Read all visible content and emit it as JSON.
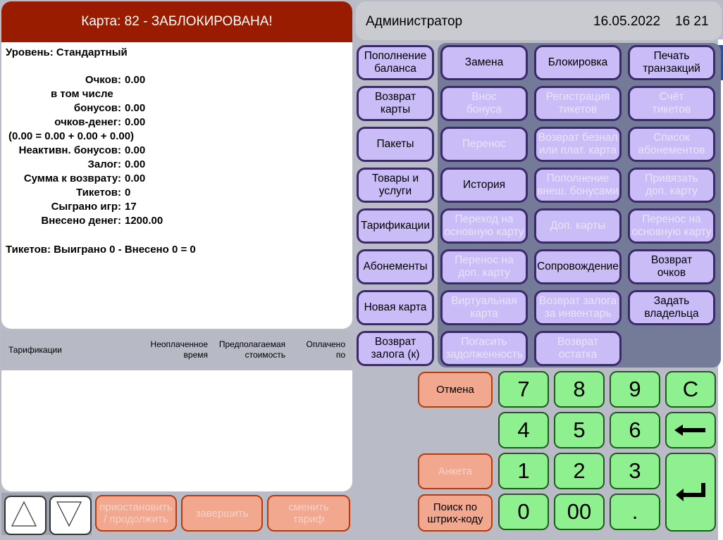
{
  "card": {
    "title": "Карта: 82  - ЗАБЛОКИРОВАНА!",
    "level": "Уровень: Стандартный",
    "stats": [
      {
        "label": "Очков:",
        "value": "0.00"
      },
      {
        "label": "в том числе",
        "value": ""
      },
      {
        "label": "бонусов:",
        "value": "0.00"
      },
      {
        "label": "очков-денег:",
        "value": "0.00"
      },
      {
        "label": "(0.00 = 0.00 + 0.00 + 0.00)",
        "value": ""
      },
      {
        "label": "Неактивн. бонусов:",
        "value": "0.00"
      },
      {
        "label": "Залог:",
        "value": "0.00"
      },
      {
        "label": "Сумма к возврату:",
        "value": "0.00"
      },
      {
        "label": "Тикетов:",
        "value": "0"
      },
      {
        "label": "Сыграно игр:",
        "value": "17"
      },
      {
        "label": "Внесено денег:",
        "value": "1200.00"
      }
    ],
    "tickets_summary": "Тикетов: Выиграно 0 - Внесено 0 = 0"
  },
  "tariffs": {
    "col_name": "Тарификации",
    "col_unpaid_1": "Неоплаченное",
    "col_unpaid_2": "время",
    "col_cost_1": "Предполагаемая",
    "col_cost_2": "стоимость",
    "col_paid_1": "Оплачено",
    "col_paid_2": "по"
  },
  "bottom": {
    "pause_1": "приостановить",
    "pause_2": "/ продолжить",
    "finish": "завершить",
    "change_1": "сменить",
    "change_2": "тариф"
  },
  "header": {
    "user": "Администратор",
    "date": "16.05.2022",
    "time": "16 21"
  },
  "left_column": [
    {
      "l1": "Пополнение",
      "l2": "баланса"
    },
    {
      "l1": "Возврат",
      "l2": "карты"
    },
    {
      "l1": "Пакеты",
      "l2": ""
    },
    {
      "l1": "Товары и",
      "l2": "услуги"
    },
    {
      "l1": "Тарификации",
      "l2": ""
    },
    {
      "l1": "Абонементы",
      "l2": ""
    },
    {
      "l1": "Новая карта",
      "l2": ""
    },
    {
      "l1": "Возврат",
      "l2": "залога (к)"
    }
  ],
  "grid": [
    {
      "l1": "Замена",
      "l2": ""
    },
    {
      "l1": "Блокировка",
      "l2": ""
    },
    {
      "l1": "Печать",
      "l2": "транзакций"
    },
    {
      "l1": "Внос",
      "l2": "бонуса"
    },
    {
      "l1": "Регистрация",
      "l2": "тикетов"
    },
    {
      "l1": "Счёт",
      "l2": "тикетов"
    },
    {
      "l1": "Перенос",
      "l2": ""
    },
    {
      "l1": "Возврат безнал",
      "l2": "или плат. карта"
    },
    {
      "l1": "Список",
      "l2": "абонементов"
    },
    {
      "l1": "История",
      "l2": ""
    },
    {
      "l1": "Пополнение",
      "l2": "внеш. бонусами"
    },
    {
      "l1": "Привязать",
      "l2": "доп. карту"
    },
    {
      "l1": "Переход на",
      "l2": "основную карту"
    },
    {
      "l1": "Доп. карты",
      "l2": ""
    },
    {
      "l1": "Перенос на",
      "l2": "основную карту"
    },
    {
      "l1": "Перенос на",
      "l2": "доп. карту"
    },
    {
      "l1": "Сопровождение",
      "l2": ""
    },
    {
      "l1": "Возврат",
      "l2": "очков"
    },
    {
      "l1": "Виртуальная",
      "l2": "карта"
    },
    {
      "l1": "Возврат залога",
      "l2": "за инвентарь"
    },
    {
      "l1": "Задать",
      "l2": "владельца"
    },
    {
      "l1": "Погасить",
      "l2": "задолженность"
    },
    {
      "l1": "Возврат",
      "l2": "остатка"
    }
  ],
  "actions": {
    "cancel": "Отмена",
    "form": "Анкета",
    "barcode_1": "Поиск по",
    "barcode_2": "штрих-коду"
  },
  "numpad": {
    "k7": "7",
    "k8": "8",
    "k9": "9",
    "clear": "C",
    "k4": "4",
    "k5": "5",
    "k6": "6",
    "k1": "1",
    "k2": "2",
    "k3": "3",
    "k0": "0",
    "k00": "00",
    "dot": "."
  },
  "colors": {
    "header_red": "#9a1c00",
    "purple_button": "#cabcf6",
    "green_key": "#8ef08e",
    "salmon_button": "#f2a78f"
  }
}
